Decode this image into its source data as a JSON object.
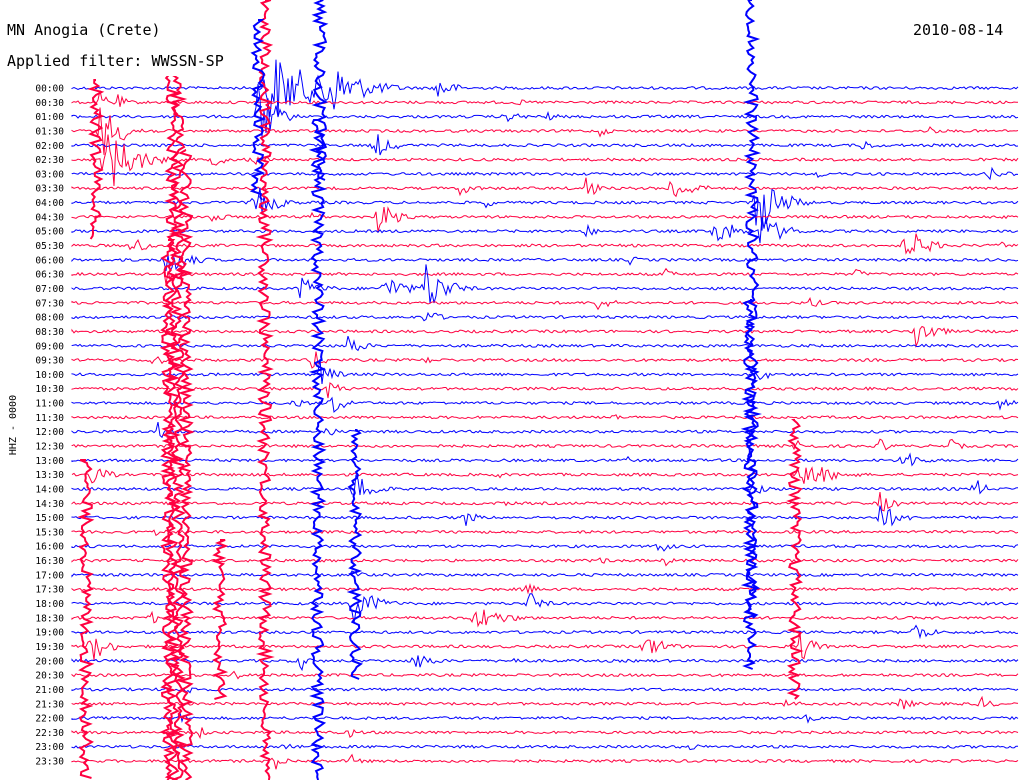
{
  "header": {
    "station": "MN Anogia (Crete)",
    "date": "2010-08-14",
    "filter": "Applied filter: WWSSN-SP"
  },
  "chart_data": {
    "type": "line",
    "ylabel": "HHZ - 0000",
    "colors": [
      "#0000ff",
      "#ff0040"
    ],
    "grid": false,
    "rows": [
      "00:00",
      "00:30",
      "01:00",
      "01:30",
      "02:00",
      "02:30",
      "03:00",
      "03:30",
      "04:00",
      "04:30",
      "05:00",
      "05:30",
      "06:00",
      "06:30",
      "07:00",
      "07:30",
      "08:00",
      "08:30",
      "09:00",
      "09:30",
      "10:00",
      "10:30",
      "11:00",
      "11:30",
      "12:00",
      "12:30",
      "13:00",
      "13:30",
      "14:00",
      "14:30",
      "15:00",
      "15:30",
      "16:00",
      "16:30",
      "17:00",
      "17:30",
      "18:00",
      "18:30",
      "19:00",
      "19:30",
      "20:00",
      "20:30",
      "21:00",
      "21:30",
      "22:00",
      "22:30",
      "23:00",
      "23:30"
    ]
  }
}
